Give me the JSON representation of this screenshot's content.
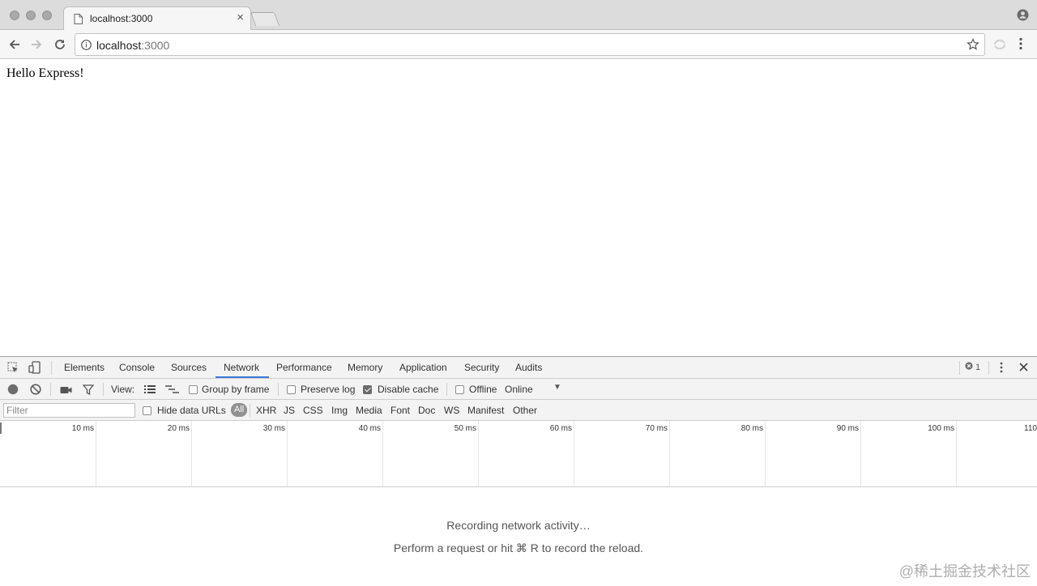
{
  "browser": {
    "tab_title": "localhost:3000",
    "url_host": "localhost",
    "url_port": ":3000"
  },
  "page": {
    "body_text": "Hello Express!"
  },
  "devtools": {
    "tabs": [
      "Elements",
      "Console",
      "Sources",
      "Network",
      "Performance",
      "Memory",
      "Application",
      "Security",
      "Audits"
    ],
    "active_tab": "Network",
    "error_count": "1",
    "toolbar": {
      "view_label": "View:",
      "group_by_frame": "Group by frame",
      "preserve_log": "Preserve log",
      "disable_cache": "Disable cache",
      "offline": "Offline",
      "throttle_value": "Online"
    },
    "filterbar": {
      "filter_placeholder": "Filter",
      "hide_data_urls": "Hide data URLs",
      "types": [
        "All",
        "XHR",
        "JS",
        "CSS",
        "Img",
        "Media",
        "Font",
        "Doc",
        "WS",
        "Manifest",
        "Other"
      ]
    },
    "timeline_ticks": [
      "10 ms",
      "20 ms",
      "30 ms",
      "40 ms",
      "50 ms",
      "60 ms",
      "70 ms",
      "80 ms",
      "90 ms",
      "100 ms",
      "110 ms"
    ],
    "empty_state": {
      "line1": "Recording network activity…",
      "line2": "Perform a request or hit ⌘ R to record the reload."
    }
  },
  "watermark": "@稀土掘金技术社区"
}
